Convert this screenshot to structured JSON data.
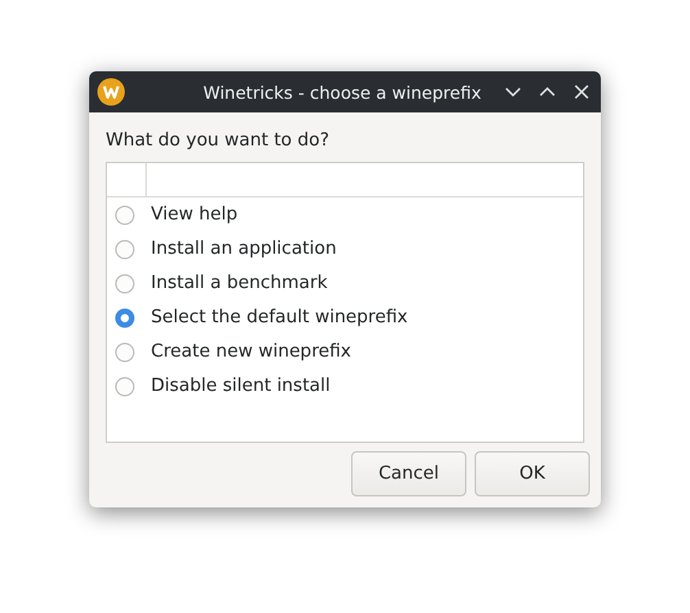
{
  "window": {
    "title": "Winetricks - choose a wineprefix"
  },
  "prompt": "What do you want to do?",
  "options": [
    {
      "label": "View help",
      "selected": false
    },
    {
      "label": "Install an application",
      "selected": false
    },
    {
      "label": "Install a benchmark",
      "selected": false
    },
    {
      "label": "Select the default wineprefix",
      "selected": true
    },
    {
      "label": "Create new wineprefix",
      "selected": false
    },
    {
      "label": "Disable silent install",
      "selected": false
    }
  ],
  "buttons": [
    "Cancel",
    "OK"
  ]
}
